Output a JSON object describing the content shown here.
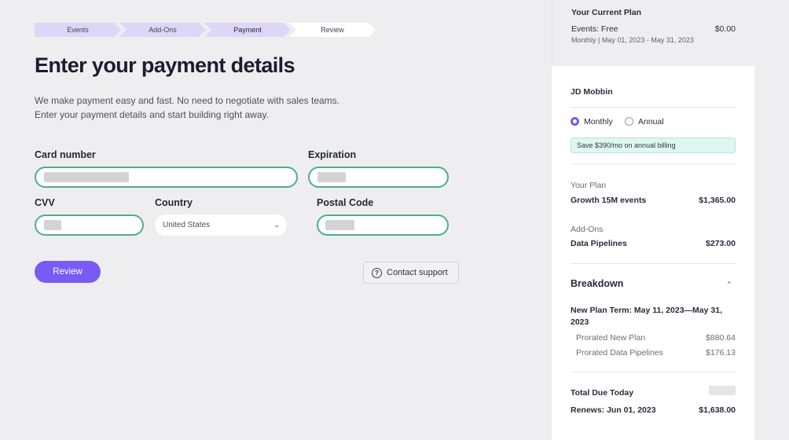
{
  "stepper": {
    "steps": [
      "Events",
      "Add-Ons",
      "Payment",
      "Review"
    ],
    "current": "Payment"
  },
  "page": {
    "title": "Enter your payment details",
    "subtitle_line1": "We make payment easy and fast. No need to negotiate with sales teams.",
    "subtitle_line2": "Enter your payment details and start building right away."
  },
  "form": {
    "card_number_label": "Card number",
    "expiration_label": "Expiration",
    "cvv_label": "CVV",
    "country_label": "Country",
    "country_value": "United States",
    "postal_label": "Postal Code",
    "review_button": "Review",
    "support_button": "Contact support"
  },
  "sidebar": {
    "current_plan_title": "Your Current Plan",
    "current_plan_name": "Events: Free",
    "current_plan_price": "$0.00",
    "current_plan_period": "Monthly | May 01, 2023 - May 31, 2023",
    "customer_name": "JD Mobbin",
    "billing_monthly": "Monthly",
    "billing_annual": "Annual",
    "billing_selected": "Monthly",
    "save_note": "Save $390/mo on annual billing",
    "your_plan_label": "Your Plan",
    "your_plan_name": "Growth 15M events",
    "your_plan_price": "$1,365.00",
    "addons_label": "Add-Ons",
    "addon_name": "Data Pipelines",
    "addon_price": "$273.00",
    "breakdown_title": "Breakdown",
    "term_line1": "New Plan Term: May 11, 2023—May 31,",
    "term_line2": "2023",
    "prorated_plan_label": "Prorated New Plan",
    "prorated_plan_value": "$880.64",
    "prorated_pipelines_label": "Prorated Data Pipelines",
    "prorated_pipelines_value": "$176.13",
    "total_due_label": "Total Due Today",
    "renews_label": "Renews: Jun 01, 2023",
    "renews_value": "$1,638.00"
  },
  "colors": {
    "accent": "#7a5af5",
    "field_border": "#4caf8a",
    "save_bg": "#dff6f1"
  }
}
